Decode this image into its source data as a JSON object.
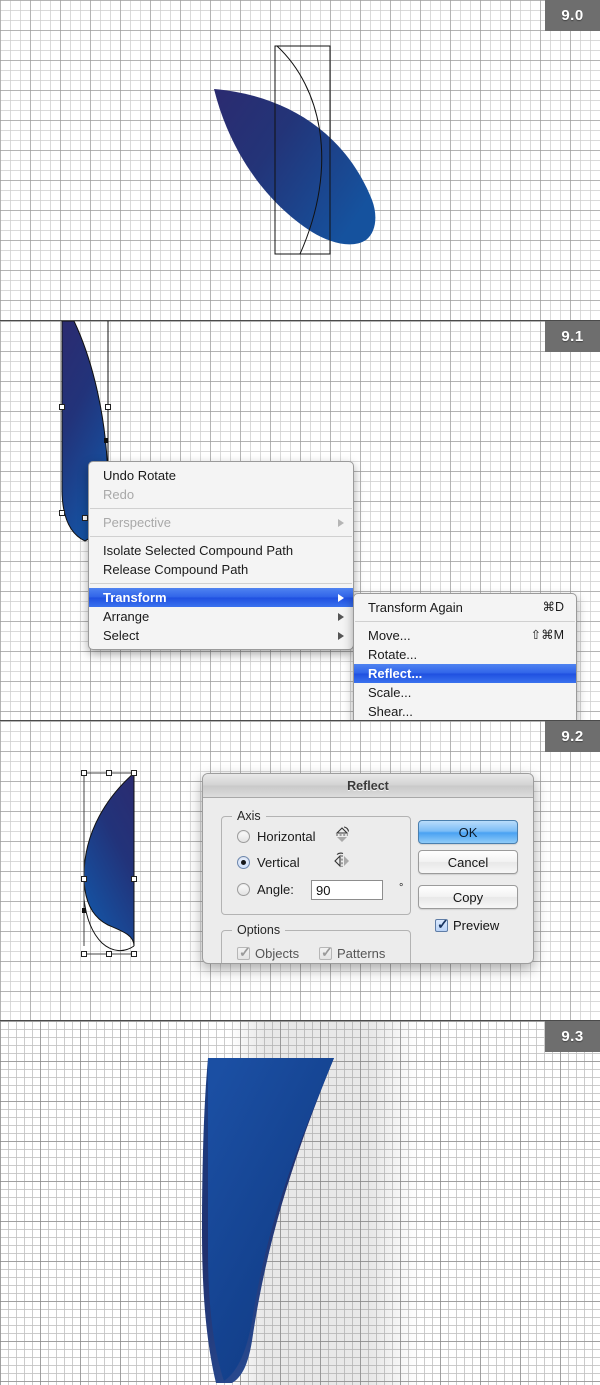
{
  "panels": [
    {
      "badge": "9.0"
    },
    {
      "badge": "9.1"
    },
    {
      "badge": "9.2"
    },
    {
      "badge": "9.3"
    }
  ],
  "context_menu": {
    "items": [
      {
        "label": "Undo Rotate",
        "shortcut": "",
        "disabled": false,
        "highlighted": false,
        "submenu": false
      },
      {
        "label": "Redo",
        "shortcut": "",
        "disabled": true,
        "highlighted": false,
        "submenu": false
      },
      {
        "separator": true
      },
      {
        "label": "Perspective",
        "shortcut": "",
        "disabled": true,
        "highlighted": false,
        "submenu": true
      },
      {
        "separator": true
      },
      {
        "label": "Isolate Selected Compound Path",
        "shortcut": "",
        "disabled": false,
        "highlighted": false,
        "submenu": false
      },
      {
        "label": "Release Compound Path",
        "shortcut": "",
        "disabled": false,
        "highlighted": false,
        "submenu": false
      },
      {
        "separator": true
      },
      {
        "label": "Transform",
        "shortcut": "",
        "disabled": false,
        "highlighted": true,
        "submenu": true
      },
      {
        "label": "Arrange",
        "shortcut": "",
        "disabled": false,
        "highlighted": false,
        "submenu": true
      },
      {
        "label": "Select",
        "shortcut": "",
        "disabled": false,
        "highlighted": false,
        "submenu": true
      }
    ]
  },
  "submenu": {
    "items": [
      {
        "label": "Transform Again",
        "shortcut": "⌘D",
        "disabled": false,
        "highlighted": false
      },
      {
        "separator": true
      },
      {
        "label": "Move...",
        "shortcut": "⇧⌘M",
        "disabled": false,
        "highlighted": false
      },
      {
        "label": "Rotate...",
        "shortcut": "",
        "disabled": false,
        "highlighted": false
      },
      {
        "label": "Reflect...",
        "shortcut": "",
        "disabled": false,
        "highlighted": true
      },
      {
        "label": "Scale...",
        "shortcut": "",
        "disabled": false,
        "highlighted": false
      },
      {
        "label": "Shear...",
        "shortcut": "",
        "disabled": false,
        "highlighted": false
      }
    ]
  },
  "dialog": {
    "title": "Reflect",
    "axis": {
      "legend": "Axis",
      "horizontal_label": "Horizontal",
      "horizontal_selected": false,
      "vertical_label": "Vertical",
      "vertical_selected": true,
      "angle_label": "Angle:",
      "angle_selected": false,
      "angle_value": "90",
      "degree_symbol": "°"
    },
    "options": {
      "legend": "Options",
      "objects_label": "Objects",
      "objects_checked": true,
      "objects_disabled": true,
      "patterns_label": "Patterns",
      "patterns_checked": true,
      "patterns_disabled": true
    },
    "buttons": {
      "ok": "OK",
      "cancel": "Cancel",
      "copy": "Copy"
    },
    "preview": {
      "label": "Preview",
      "checked": true
    }
  },
  "colors": {
    "accent_blue": "#1a4fa0",
    "shape_dark": "#2a2a6e",
    "shape_light": "#1550a8",
    "badge_bg": "#6e6e6e",
    "menu_highlight": "#2f63e8",
    "dialog_bg": "#ececec"
  }
}
